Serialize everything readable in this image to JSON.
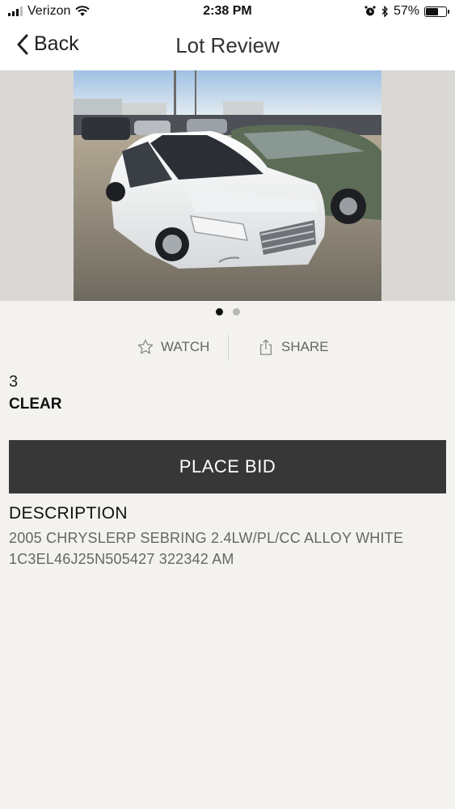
{
  "status_bar": {
    "carrier": "Verizon",
    "time": "2:38 PM",
    "battery_text": "57%",
    "battery_level": 0.57,
    "icons": [
      "signal-icon",
      "wifi-icon",
      "alarm-icon",
      "bluetooth-icon",
      "battery-icon"
    ]
  },
  "nav": {
    "back_label": "Back",
    "title": "Lot Review",
    "back_icon": "chevron-left-icon"
  },
  "gallery": {
    "image_description_icon": "car-photo",
    "page_count": 2,
    "active_index": 0
  },
  "actions": {
    "watch_label": "WATCH",
    "watch_icon": "star-outline-icon",
    "share_label": "SHARE",
    "share_icon": "share-icon"
  },
  "lot": {
    "number": "3",
    "status": "CLEAR"
  },
  "place_bid_label": "PLACE BID",
  "description": {
    "heading": "DESCRIPTION",
    "line1": "2005  CHRYSLERP SEBRING 2.4LW/PL/CC ALLOY WHITE",
    "line2": "1C3EL46J25N505427 322342 AM"
  },
  "colors": {
    "button_bg": "#373737",
    "page_bg": "#f3f2ef",
    "muted_text": "#666666"
  }
}
